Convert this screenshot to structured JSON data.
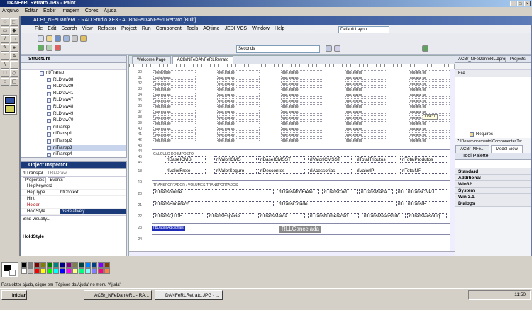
{
  "paint": {
    "title": "DANFeRLRetrato.JPG - Paint",
    "menu": [
      "Arquivo",
      "Editar",
      "Exibir",
      "Imagem",
      "Cores",
      "Ajuda"
    ],
    "status": "Para obter ajuda, clique em 'Tópicos da Ajuda' no menu 'Ajuda'."
  },
  "ide": {
    "title": "ACBr_NFeDanfeRL - RAD Studio XE3 - ACBrNFeDANFeRLRetrato [Built]",
    "menu": [
      "File",
      "Edit",
      "Search",
      "View",
      "Refactor",
      "Project",
      "Run",
      "Component",
      "Tools",
      "AQtime",
      "JEDI VCS",
      "Window",
      "Help"
    ],
    "layout_combo": "Default Layout",
    "seconds_combo": "Seconds"
  },
  "structure": {
    "title": "Structure",
    "items": [
      "rlbTransp",
      "RLDraw38",
      "RLDraw39",
      "RLDraw41",
      "RLDraw47",
      "RLDraw48",
      "RLDraw49",
      "RLDraw70",
      "rliTransp",
      "rliTransp1",
      "rliTransp2",
      "rliTransp3",
      "rliTransp4"
    ]
  },
  "inspector": {
    "title": "Object Inspector",
    "selected": "rliTransp3",
    "selected_type": "TRLDraw",
    "tabs": [
      "Properties",
      "Events"
    ],
    "rows": [
      {
        "k": "HelpKeyword",
        "v": ""
      },
      {
        "k": "HelpType",
        "v": "htContext"
      },
      {
        "k": "Hint",
        "v": ""
      },
      {
        "k": "Holder",
        "v": ""
      },
      {
        "k": "HoldStyle",
        "v": "hsRelatively"
      }
    ],
    "bind": "Bind Visually...",
    "footer": "HoldStyle"
  },
  "designer": {
    "tabs": [
      "Welcome Page",
      "ACBrNFeDANFeRLRetrato"
    ],
    "row_nums": [
      "30",
      "31",
      "32",
      "33",
      "34",
      "35",
      "36",
      "37",
      "38",
      "39",
      "40",
      "41",
      "42",
      "43",
      "44",
      "45",
      "46"
    ],
    "band_nums": [
      "18",
      "19",
      "20",
      "21",
      "22",
      "23",
      "24"
    ],
    "sections": {
      "calculo": "CÁLCULO DO IMPOSTO",
      "transportador": "TRANSPORTADOR / VOLUMES TRANSPORTADOS"
    },
    "fields": {
      "r1": [
        "rlBaseICMS",
        "rlValorICMS",
        "rlBaseICMSST",
        "rlValorICMSST",
        "rlTotalTributos",
        "rlTotalProdutos"
      ],
      "r2": [
        "rlValorFrete",
        "rlValorSeguro",
        "rlDescontos",
        "rlAcessorias",
        "rlValorIPI",
        "rlTotalNF"
      ],
      "r3": [
        "rlTransNome",
        "rlTransModFrete",
        "rlTransCod",
        "rlTransPlaca",
        "rlTr",
        "rlTransCNPJ"
      ],
      "r4": [
        "rlTransEndereco",
        "rlTransCidade",
        "rlTr",
        "rlTransIE"
      ],
      "r5": [
        "rlTransQTDE",
        "rlTransEspecie",
        "rlTransMarca",
        "rlTransNumeracao",
        "rlTransPesoBruto",
        "rlTransPesoLiq"
      ]
    },
    "cancel_label": "RLLCancelada",
    "badge": "rlbDadosAdicionais",
    "date_sample": "99/99/9999",
    "num_sample": "999.999,99",
    "hint": "Line: 1"
  },
  "project": {
    "title": "ACBr_NFeDanfeRL.dproj - Projects",
    "file_label": "File",
    "requires": "Requires",
    "path": "Z:\\Desenvolvimento\\ComponentesTer",
    "tabs": [
      "ACBr_NFe...",
      "Model View"
    ],
    "palette_title": "Tool Palette",
    "palette": [
      "Standard",
      "Additional",
      "Win32",
      "System",
      "Win 3.1",
      "Dialogs"
    ]
  },
  "taskbar": {
    "start": "Iniciar",
    "tasks": [
      "ACBr_NFeDanfeRL - RA...",
      "DANFeRLRetrato.JPG - ..."
    ],
    "time": "11:50"
  },
  "colors": {
    "paint_title": "#0a246a",
    "ide_title": "#1a3a7a",
    "cancel_bg": "#8a8a8a",
    "badge_bg": "#1e2ab8"
  }
}
